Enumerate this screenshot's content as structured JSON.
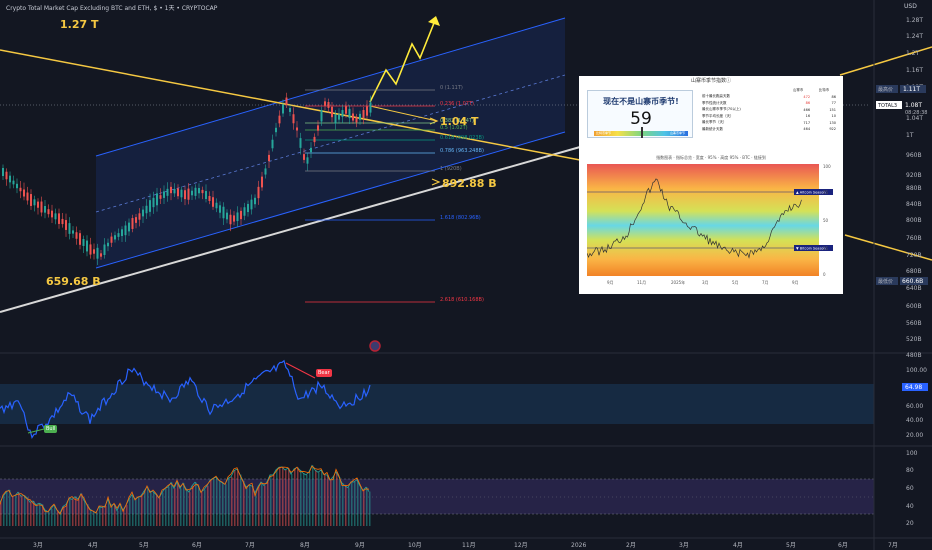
{
  "header": {
    "title": "Crypto Total Market Cap Excluding BTC and ETH, $ • 1天 • CRYPTOCAP",
    "currency": "USD"
  },
  "price_axis": {
    "labels": [
      "1.28T",
      "1.24T",
      "1.2T",
      "1.16T",
      "1.12T",
      "1.04T",
      "1T",
      "960B",
      "920B",
      "880B",
      "840B",
      "800B",
      "760B",
      "720B",
      "680B",
      "640B",
      "600B",
      "560B",
      "520B",
      "480B"
    ],
    "high_tag": "最高价",
    "high_value": "1.11T",
    "low_tag": "最低价",
    "low_value": "660.6B",
    "symbol_tag": "TOTAL3",
    "current_value": "1.08T",
    "countdown": "08:28:38"
  },
  "time_axis": [
    "3月",
    "4月",
    "5月",
    "6月",
    "7月",
    "8月",
    "9月",
    "10月",
    "11月",
    "12月",
    "2026",
    "2月",
    "3月",
    "4月",
    "5月",
    "6月",
    "7月"
  ],
  "annotations": {
    "top_left": "1.27 T",
    "bottom_left": "659.68 B",
    "right_target": "1.04 T",
    "right_low": "892.88 B"
  },
  "fib_levels": [
    {
      "ratio": "0 (1.11T)",
      "color": "#787b86"
    },
    {
      "ratio": "0.236 (1.07T)",
      "color": "#f23645"
    },
    {
      "ratio": "0.382 (1.04T)",
      "color": "#81c784"
    },
    {
      "ratio": "0.5 (1.02T)",
      "color": "#4caf50"
    },
    {
      "ratio": "0.618 (998.023B)",
      "color": "#089981"
    },
    {
      "ratio": "0.786 (963.248B)",
      "color": "#64b5f6"
    },
    {
      "ratio": "1 (920B)",
      "color": "#787b86"
    },
    {
      "ratio": "1.618 (802.96B)",
      "color": "#2962ff"
    },
    {
      "ratio": "2.618 (610.168B)",
      "color": "#f23645"
    }
  ],
  "rsi": {
    "labels": [
      "100.00",
      "80.00",
      "60.00",
      "40.00",
      "20.00"
    ],
    "value": "64.98",
    "bull_label": "Bull",
    "bear_label": "Bear"
  },
  "stoch": {
    "labels": [
      "100",
      "80",
      "60",
      "40",
      "20"
    ]
  },
  "inset": {
    "title": "山寨币季节指数ⓘ",
    "headline": "现在不是山寨币季节!",
    "value": "59",
    "grad_left": "比特币季节",
    "grad_right": "山寨币季节",
    "table_header": [
      "",
      "山寨币",
      "比特币"
    ],
    "table_rows": [
      [
        "前十最长跑赢天数",
        "472",
        "86"
      ],
      [
        "季节性统计天数",
        "86",
        "77"
      ],
      [
        "最长山寨币季节(70以上)",
        "466",
        "151"
      ],
      [
        "季节平均长度（天）",
        "16",
        "10"
      ],
      [
        "最长季节（天）",
        "717",
        "130"
      ],
      [
        "最新统计天数",
        "464",
        "922"
      ]
    ],
    "sub_title": "指数图表 · 指标总览 · 宽度 · 95% · 高度 95% · BTC · 链接到",
    "altcoin_tag": "▲ Altcoin Season",
    "bitcoin_tag": "▼ Bitcoin Season",
    "altcoin_val": "75",
    "bitcoin_val": "25",
    "x_labels": [
      "9月",
      "11月",
      "2025年",
      "3月",
      "5月",
      "7月",
      "9月"
    ],
    "y_labels": [
      "100",
      "75",
      "50",
      "25",
      "0"
    ]
  }
}
